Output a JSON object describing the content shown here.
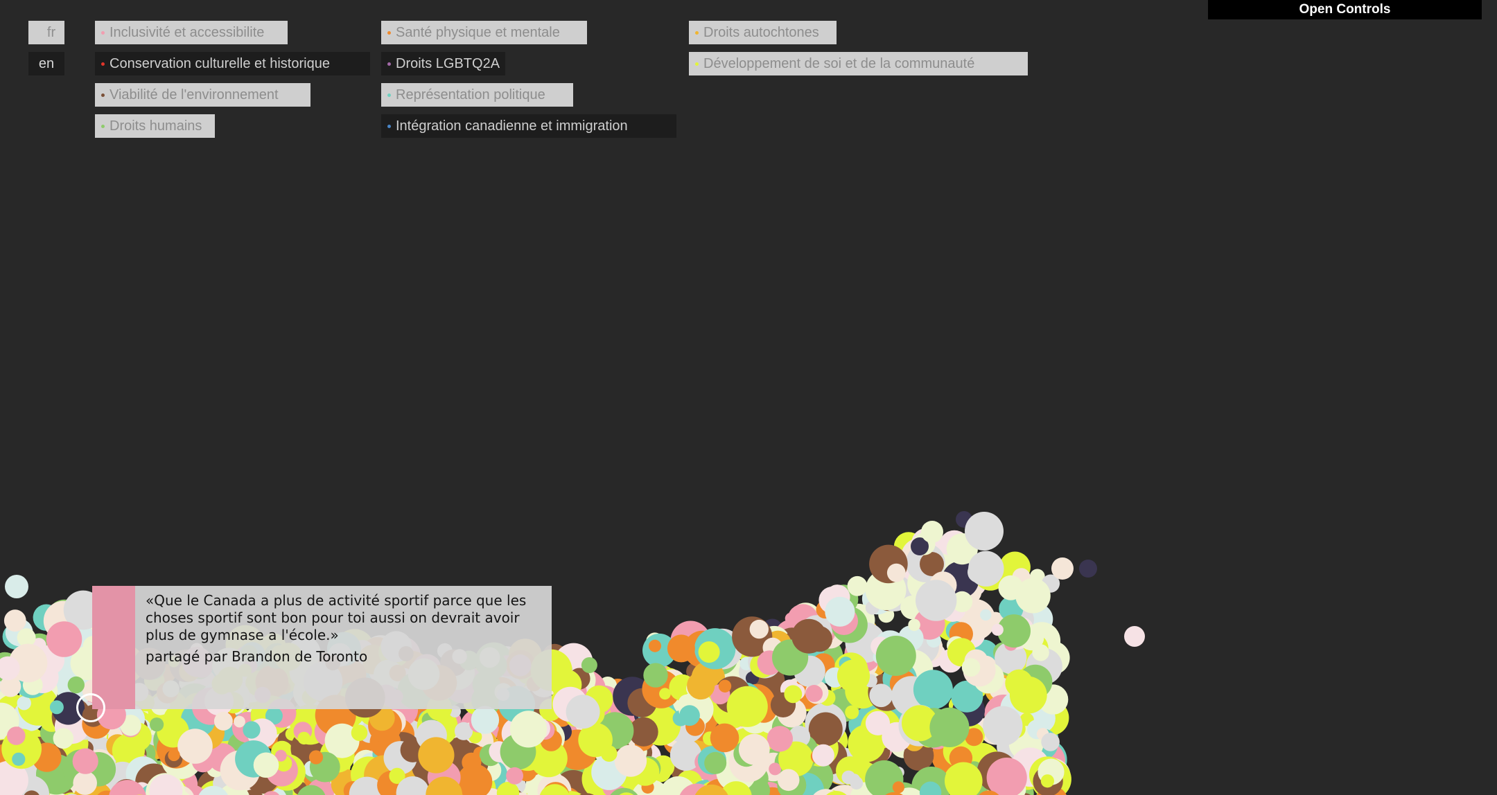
{
  "languages": {
    "fr": "fr",
    "en": "en",
    "selected": "en"
  },
  "controls": {
    "open_label": "Open Controls"
  },
  "categories": {
    "col1": [
      {
        "label": "Inclusivité et accessibilite",
        "color": "#f29db0",
        "active": false
      },
      {
        "label": "Conservation culturelle et historique",
        "color": "#e0352b",
        "active": true
      },
      {
        "label": "Viabilité de l'environnement",
        "color": "#7b5037",
        "active": false
      },
      {
        "label": "Droits humains",
        "color": "#8ecb6b",
        "active": false
      }
    ],
    "col2": [
      {
        "label": "Santé physique et mentale",
        "color": "#f08a2c",
        "active": false
      },
      {
        "label": "Droits LGBTQ2A",
        "color": "#a36aa8",
        "active": true
      },
      {
        "label": "Représentation politique",
        "color": "#6fd0c0",
        "active": false
      },
      {
        "label": "Intégration canadienne et immigration",
        "color": "#4a86c7",
        "active": true
      }
    ],
    "col3": [
      {
        "label": "Droits autochtones",
        "color": "#f0b530",
        "active": false
      },
      {
        "label": "Développement de soi et de la communauté",
        "color": "#e2f53a",
        "active": false
      }
    ]
  },
  "quote": {
    "text": "«Que le Canada a plus de activité sportif parce que les choses sportif sont bon pour toi aussi on devrait avoir plus de gymnase a l'école.»",
    "author_prefix": "partagé par",
    "author": "Brandon de Toronto",
    "accent_color": "#e393a7"
  },
  "bubble_palette": [
    "#e2f53a",
    "#8b5a3c",
    "#f29db0",
    "#f08a2c",
    "#8ecb6b",
    "#6fd0c0",
    "#f0b530",
    "#eef5d0",
    "#f5e6d8",
    "#dcdcdc",
    "#d9ece9",
    "#f6e2e5",
    "#3a3550"
  ]
}
